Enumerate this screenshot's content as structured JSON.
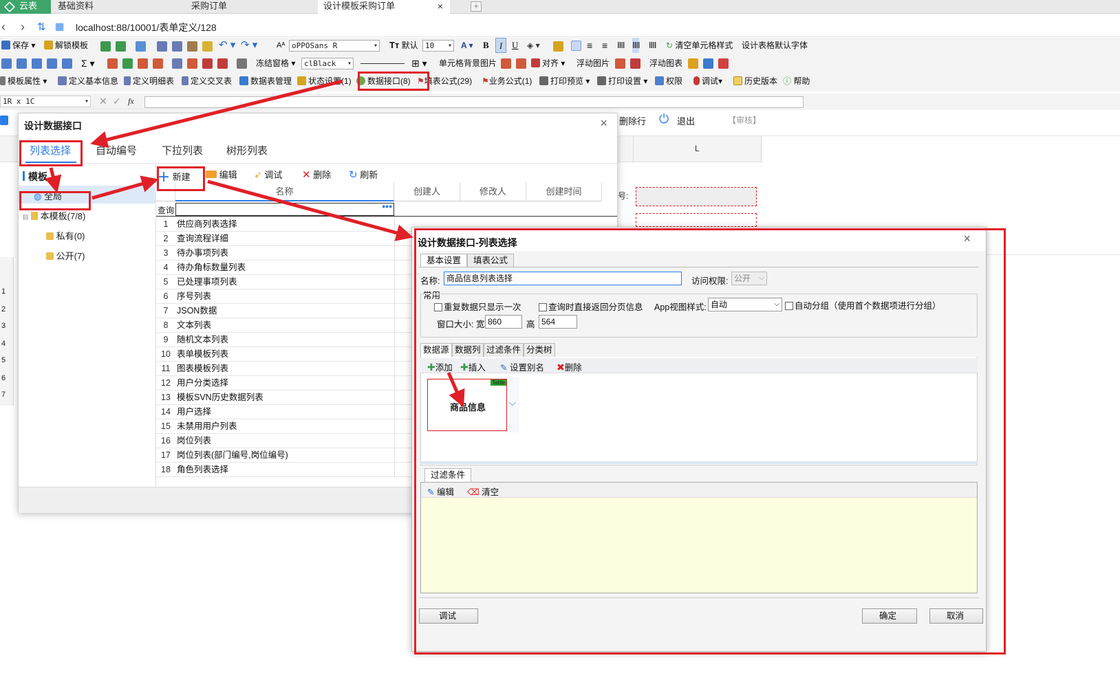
{
  "tabs": {
    "home": "云表",
    "t1": "基础资料",
    "t2": "采购订单",
    "t3": "设计模板采购订单",
    "close": "×",
    "new": "+"
  },
  "address": {
    "url": "localhost:88/10001/表单定义/128"
  },
  "toolbar1": {
    "save": "保存",
    "unlock": "解锁模板",
    "font_name": "oPPOSans R",
    "default": "默认",
    "font_size": "10",
    "bold": "B",
    "italic": "I",
    "underline": "U",
    "clear_cell_style": "清空单元格样式",
    "design_default_font": "设计表格默认字体"
  },
  "toolbar2": {
    "freeze": "冻结窗格",
    "color": "clBlack",
    "cell_bg_image": "单元格背景图片",
    "align": "对齐",
    "float_image": "浮动图片",
    "float_chart": "浮动图表"
  },
  "toolbar3": {
    "template_props": "模板属性",
    "define_basic": "定义基本信息",
    "define_detail": "定义明细表",
    "define_cross": "定义交叉表",
    "data_table_mgmt": "数据表管理",
    "status_settings": "状态设置(1)",
    "data_interface": "数据接口(8)",
    "fill_formula": "填表公式(29)",
    "biz_formula": "业务公式(1)",
    "print_preview": "打印预览",
    "print_settings": "打印设置",
    "permissions": "权限",
    "debug": "调试",
    "history": "历史版本",
    "help": "帮助"
  },
  "formula_bar": {
    "cell_ref": "1R x 1C",
    "fx": "fx"
  },
  "sheet": {
    "delete_row": "删除行",
    "exit": "退出",
    "audit": "【审核】",
    "col_L": "L",
    "number": "号:",
    "rows": [
      "1",
      "2",
      "3",
      "4",
      "5",
      "6",
      "7"
    ]
  },
  "dialog1": {
    "title": "设计数据接口",
    "close": "×",
    "tabs": [
      "列表选择",
      "自动编号",
      "下拉列表",
      "树形列表"
    ],
    "tree_header": "模板",
    "tree": {
      "global": "全局",
      "this_template": "本模板(7/8)",
      "private": "私有(0)",
      "public": "公开(7)"
    },
    "toolbar": {
      "new": "新建",
      "edit": "编辑",
      "debug": "调试",
      "delete": "删除",
      "refresh": "刷新"
    },
    "columns": [
      "名称",
      "创建人",
      "修改人",
      "创建时间"
    ],
    "query_label": "查询",
    "rows": [
      {
        "n": "1",
        "name": "供应商列表选择"
      },
      {
        "n": "2",
        "name": "查询流程详细"
      },
      {
        "n": "3",
        "name": "待办事项列表"
      },
      {
        "n": "4",
        "name": "待办角标数量列表"
      },
      {
        "n": "5",
        "name": "已处理事项列表"
      },
      {
        "n": "6",
        "name": "序号列表"
      },
      {
        "n": "7",
        "name": "JSON数据"
      },
      {
        "n": "8",
        "name": "文本列表"
      },
      {
        "n": "9",
        "name": "随机文本列表"
      },
      {
        "n": "10",
        "name": "表单模板列表"
      },
      {
        "n": "11",
        "name": "图表模板列表"
      },
      {
        "n": "12",
        "name": "用户分类选择"
      },
      {
        "n": "13",
        "name": "模板SVN历史数据列表"
      },
      {
        "n": "14",
        "name": "用户选择"
      },
      {
        "n": "15",
        "name": "未禁用用户列表"
      },
      {
        "n": "16",
        "name": "岗位列表"
      },
      {
        "n": "17",
        "name": "岗位列表(部门编号,岗位编号)"
      },
      {
        "n": "18",
        "name": "角色列表选择"
      }
    ]
  },
  "dialog2": {
    "title": "设计数据接口-列表选择",
    "close": "×",
    "tabs": [
      "基本设置",
      "填表公式"
    ],
    "name_label": "名称:",
    "name_value": "商品信息列表选择",
    "access_label": "访问权限:",
    "access_value": "公开",
    "common": "常用",
    "repeat_once": "重复数据只显示一次",
    "return_paging": "查询时直接返回分页信息",
    "app_view_label": "App视图样式:",
    "app_view_value": "自动",
    "auto_group": "自动分组（使用首个数据项进行分组）",
    "window_size": "窗口大小: 宽",
    "width": "860",
    "height_label": "高",
    "height": "564",
    "sub_tabs": [
      "数据源",
      "数据列",
      "过滤条件",
      "分类树"
    ],
    "ds_toolbar": {
      "add": "添加",
      "insert": "插入",
      "alias": "设置别名",
      "delete": "删除"
    },
    "ds_card": {
      "name": "商品信息",
      "badge": "Table"
    },
    "filter_tab": "过滤条件",
    "filter_toolbar": {
      "edit": "编辑",
      "clear": "清空"
    },
    "buttons": {
      "debug": "调试",
      "ok": "确定",
      "cancel": "取消"
    }
  },
  "colors": {
    "accent": "#2b7de9",
    "annotation": "#e02028",
    "home_tab": "#3ea66b",
    "filter_bg": "#fdfde0"
  }
}
